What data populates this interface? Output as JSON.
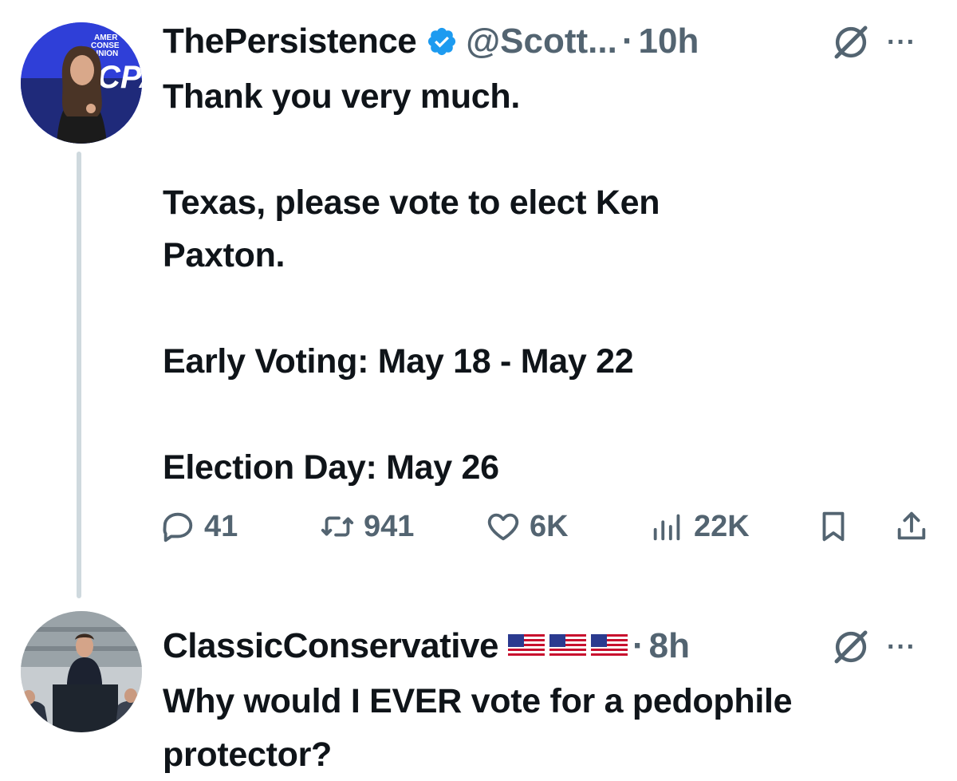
{
  "colors": {
    "text": "#0f1419",
    "muted": "#536471",
    "verified": "#1d9bf0",
    "thread_line": "#cfd9de"
  },
  "tweets": [
    {
      "avatar_text": [
        "AMER",
        "CONSE",
        "UNION",
        "CPA"
      ],
      "name": "ThePersistence",
      "verified": true,
      "handle": "@Scott...",
      "separator": "·",
      "time": "10h",
      "more": "···",
      "body": [
        "Thank you very much.",
        "Texas, please vote to elect Ken Paxton.",
        "Early Voting: May 18 - May 22",
        "Election Day: May 26"
      ],
      "stats": {
        "replies": "41",
        "reposts": "941",
        "likes": "6K",
        "views": "22K"
      }
    },
    {
      "name": "ClassicConservative",
      "flags": [
        "us-flag",
        "us-flag",
        "us-flag"
      ],
      "separator": "·",
      "time": "8h",
      "more": "···",
      "body": [
        "Why would I EVER vote for a pedophile protector?"
      ]
    }
  ],
  "icons": {
    "verified": "verified-badge-icon",
    "grok": "grok-icon",
    "reply": "reply-icon",
    "repost": "repost-icon",
    "like": "like-icon",
    "views": "views-icon",
    "bookmark": "bookmark-icon",
    "share": "share-icon"
  }
}
